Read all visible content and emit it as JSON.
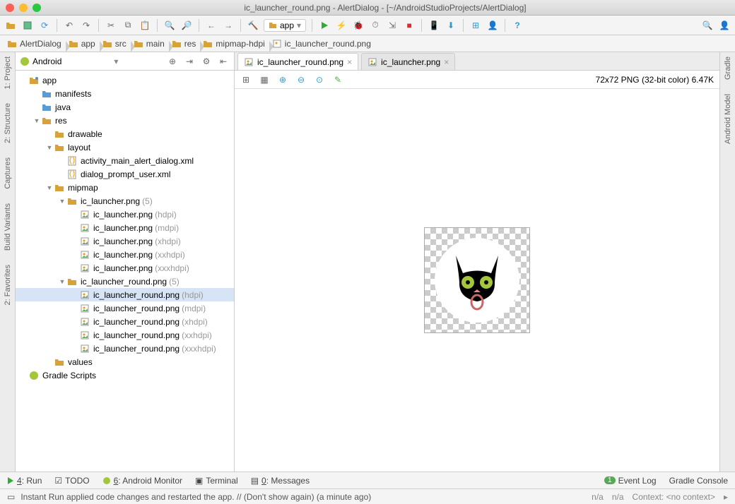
{
  "window": {
    "title": "ic_launcher_round.png - AlertDialog - [~/AndroidStudioProjects/AlertDialog]"
  },
  "run_config": "app",
  "breadcrumbs": [
    {
      "icon": "folder",
      "label": "AlertDialog"
    },
    {
      "icon": "folder",
      "label": "app"
    },
    {
      "icon": "folder",
      "label": "src"
    },
    {
      "icon": "folder",
      "label": "main"
    },
    {
      "icon": "folder",
      "label": "res"
    },
    {
      "icon": "folder",
      "label": "mipmap-hdpi"
    },
    {
      "icon": "image",
      "label": "ic_launcher_round.png"
    }
  ],
  "left_tools": [
    "1: Project",
    "2: Structure",
    "Captures",
    "Build Variants",
    "2: Favorites"
  ],
  "right_tools": [
    "Gradle",
    "Android Model"
  ],
  "project_header": {
    "view": "Android"
  },
  "tree": {
    "root": {
      "label": "app",
      "icon": "module",
      "expanded": true
    },
    "children": [
      {
        "label": "manifests",
        "icon": "folder-blue",
        "expanded": false,
        "depth": 1
      },
      {
        "label": "java",
        "icon": "folder-blue",
        "expanded": false,
        "depth": 1
      },
      {
        "label": "res",
        "icon": "folder-res",
        "expanded": true,
        "depth": 1,
        "children": [
          {
            "label": "drawable",
            "icon": "folder-res",
            "depth": 2
          },
          {
            "label": "layout",
            "icon": "folder-res",
            "expanded": true,
            "depth": 2,
            "children": [
              {
                "label": "activity_main_alert_dialog.xml",
                "icon": "xml",
                "depth": 3
              },
              {
                "label": "dialog_prompt_user.xml",
                "icon": "xml",
                "depth": 3
              }
            ]
          },
          {
            "label": "mipmap",
            "icon": "folder-res",
            "expanded": true,
            "depth": 2,
            "children": [
              {
                "label": "ic_launcher.png",
                "hint": "(5)",
                "icon": "image-group",
                "expanded": true,
                "depth": 3,
                "children": [
                  {
                    "label": "ic_launcher.png",
                    "hint": "(hdpi)",
                    "icon": "image",
                    "depth": 4
                  },
                  {
                    "label": "ic_launcher.png",
                    "hint": "(mdpi)",
                    "icon": "image",
                    "depth": 4
                  },
                  {
                    "label": "ic_launcher.png",
                    "hint": "(xhdpi)",
                    "icon": "image",
                    "depth": 4
                  },
                  {
                    "label": "ic_launcher.png",
                    "hint": "(xxhdpi)",
                    "icon": "image",
                    "depth": 4
                  },
                  {
                    "label": "ic_launcher.png",
                    "hint": "(xxxhdpi)",
                    "icon": "image",
                    "depth": 4
                  }
                ]
              },
              {
                "label": "ic_launcher_round.png",
                "hint": "(5)",
                "icon": "image-group",
                "expanded": true,
                "depth": 3,
                "children": [
                  {
                    "label": "ic_launcher_round.png",
                    "hint": "(hdpi)",
                    "icon": "image",
                    "depth": 4,
                    "selected": true
                  },
                  {
                    "label": "ic_launcher_round.png",
                    "hint": "(mdpi)",
                    "icon": "image",
                    "depth": 4
                  },
                  {
                    "label": "ic_launcher_round.png",
                    "hint": "(xhdpi)",
                    "icon": "image",
                    "depth": 4
                  },
                  {
                    "label": "ic_launcher_round.png",
                    "hint": "(xxhdpi)",
                    "icon": "image",
                    "depth": 4
                  },
                  {
                    "label": "ic_launcher_round.png",
                    "hint": "(xxxhdpi)",
                    "icon": "image",
                    "depth": 4
                  }
                ]
              }
            ]
          },
          {
            "label": "values",
            "icon": "folder-res",
            "depth": 2
          }
        ]
      },
      {
        "label": "Gradle Scripts",
        "icon": "gradle",
        "depth": 0
      }
    ]
  },
  "editor_tabs": [
    {
      "label": "ic_launcher_round.png",
      "active": true
    },
    {
      "label": "ic_launcher.png",
      "active": false
    }
  ],
  "image_info": "72x72 PNG (32-bit color) 6.47K",
  "bottom_tools": [
    {
      "key": "4",
      "label": "Run",
      "icon": "run"
    },
    {
      "key": "",
      "label": "TODO",
      "icon": "todo"
    },
    {
      "key": "6",
      "label": "Android Monitor",
      "icon": "android"
    },
    {
      "key": "",
      "label": "Terminal",
      "icon": "terminal"
    },
    {
      "key": "0",
      "label": "Messages",
      "icon": "messages"
    }
  ],
  "bottom_right": [
    {
      "label": "Event Log",
      "icon": "event",
      "badge": "1"
    },
    {
      "label": "Gradle Console",
      "icon": "gradle"
    }
  ],
  "status": {
    "message": "Instant Run applied code changes and restarted the app. // (Don't show again) (a minute ago)",
    "right": [
      "n/a",
      "n/a",
      "Context: <no context>"
    ]
  }
}
